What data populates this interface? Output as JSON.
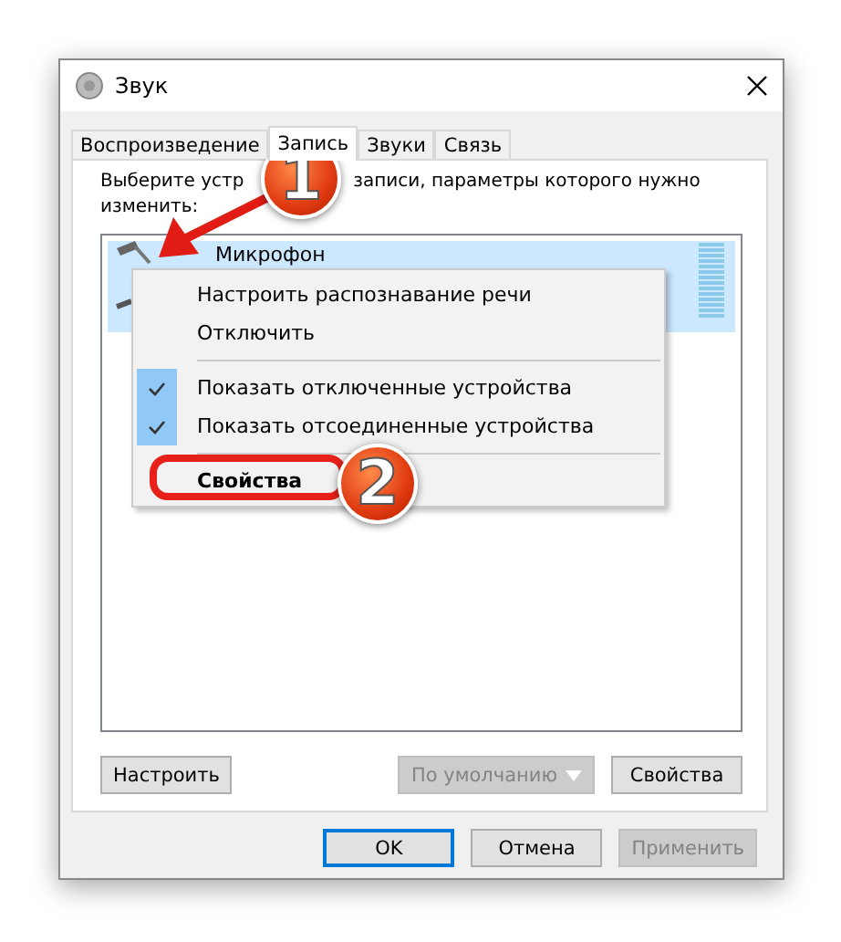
{
  "window": {
    "title": "Звук"
  },
  "tabs": [
    {
      "label": "Воспроизведение",
      "selected": false
    },
    {
      "label": "Запись",
      "selected": true
    },
    {
      "label": "Звуки",
      "selected": false
    },
    {
      "label": "Связь",
      "selected": false
    }
  ],
  "instruction": [
    "Выберите устр",
    "записи, параметры которого нужно",
    "изменить:"
  ],
  "devices": [
    {
      "name": "Микрофон",
      "selected": true
    }
  ],
  "panel_buttons": [
    {
      "kind": "button",
      "label": "Настроить",
      "disabled": false
    },
    {
      "kind": "spacer"
    },
    {
      "kind": "split",
      "label": "По умолчанию",
      "disabled": true
    },
    {
      "kind": "button",
      "label": "Свойства",
      "disabled": false
    }
  ],
  "dialog_buttons": [
    {
      "label": "OK",
      "default": true,
      "disabled": false
    },
    {
      "label": "Отмена",
      "default": false,
      "disabled": false
    },
    {
      "label": "Применить",
      "default": false,
      "disabled": true
    }
  ],
  "context_menu": [
    {
      "kind": "item",
      "label": "Настроить распознавание речи",
      "checked": false,
      "bold": false
    },
    {
      "kind": "item",
      "label": "Отключить",
      "checked": false,
      "bold": false
    },
    {
      "kind": "separator"
    },
    {
      "kind": "item",
      "label": "Показать отключенные устройства",
      "checked": true,
      "bold": false
    },
    {
      "kind": "item",
      "label": "Показать отсоединенные устройства",
      "checked": true,
      "bold": false
    },
    {
      "kind": "separator"
    },
    {
      "kind": "item",
      "label": "Свойства",
      "checked": false,
      "bold": true
    }
  ],
  "annotations": [
    {
      "label": "1"
    },
    {
      "label": "2"
    }
  ]
}
